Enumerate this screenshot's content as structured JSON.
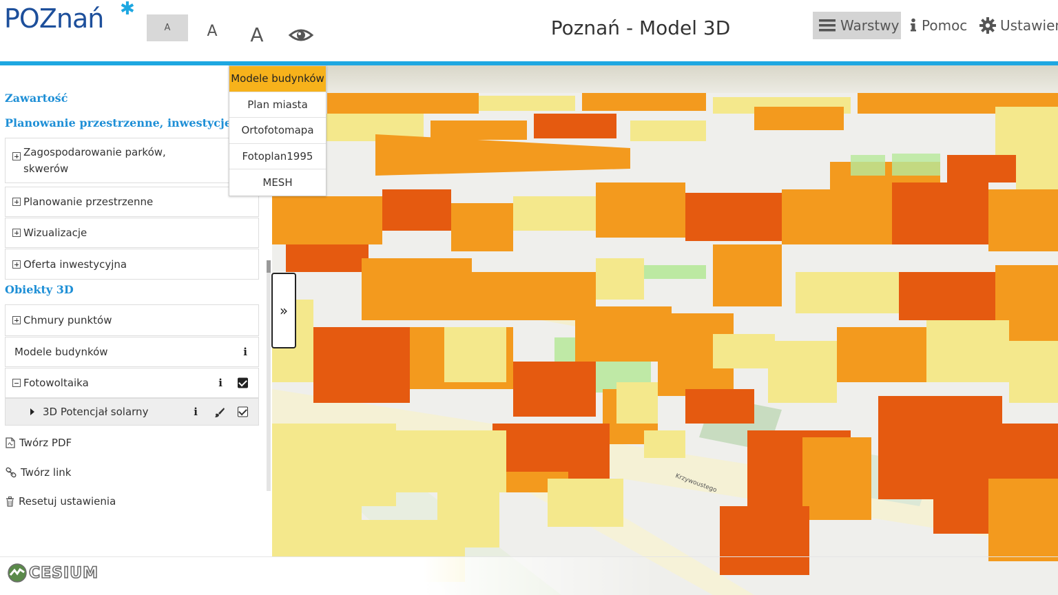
{
  "header": {
    "logo_text": "POZnań",
    "font_sizes": {
      "small": "A",
      "medium": "A",
      "large": "A"
    },
    "title": "Poznań - Model 3D",
    "layers_label": "Warstwy",
    "help_label": "Pomoc",
    "settings_label": "Ustawien"
  },
  "base_layers": {
    "options": [
      "Modele budynków",
      "Plan miasta",
      "Ortofotomapa",
      "Fotoplan1995",
      "MESH"
    ],
    "active": "Modele budynków"
  },
  "sidebar": {
    "content_heading": "Zawartość",
    "planning_heading": "Planowanie przestrzenne, inwestycje",
    "planning_items": [
      {
        "label": "Zagospodarowanie parków, skwerów"
      },
      {
        "label": "Planowanie przestrzenne"
      },
      {
        "label": "Wizualizacje"
      },
      {
        "label": "Oferta inwestycyjna"
      }
    ],
    "objects_heading": "Obiekty 3D",
    "objects_items": [
      {
        "label": "Chmury punktów"
      },
      {
        "label": "Modele budynków"
      },
      {
        "label": "Fotowoltaika"
      }
    ],
    "sub_item_label": "3D Potencjał solarny",
    "info_glyph": "i",
    "toggle_glyph": "»"
  },
  "tools": {
    "pdf": "Twórz PDF",
    "link": "Twórz link",
    "reset": "Resetuj ustawienia"
  },
  "map": {
    "street_label": "Krzywoustego",
    "credit": "CESIUM"
  },
  "colors": {
    "accent": "#1ea7e1",
    "brand_blue": "#1d4f9b",
    "active_layer": "#f7b21b",
    "solar_high": "#e55a10",
    "solar_mid": "#f39a1e",
    "solar_low": "#f4e88c",
    "planned": "#b6e89a"
  }
}
